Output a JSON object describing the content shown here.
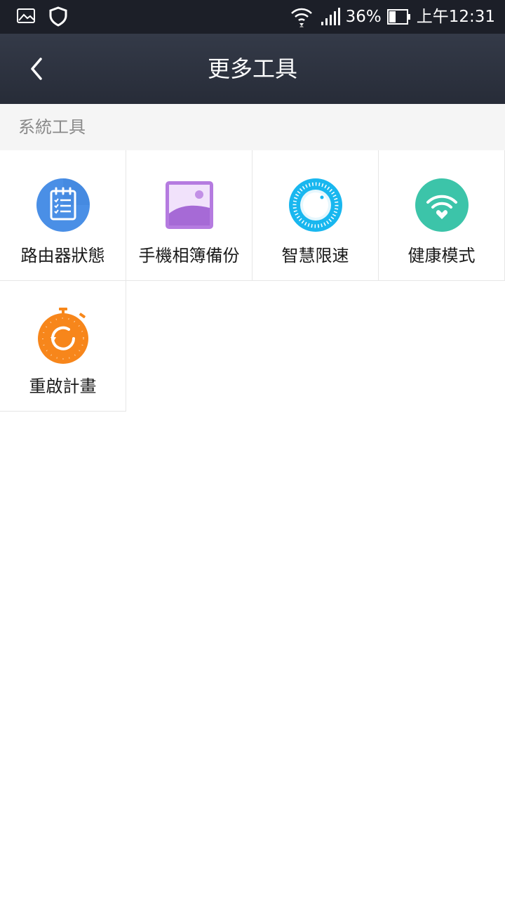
{
  "status_bar": {
    "battery_percent": "36%",
    "time": "上午12:31"
  },
  "header": {
    "title": "更多工具"
  },
  "section": {
    "title": "系統工具"
  },
  "tools": [
    {
      "label": "路由器狀態",
      "icon": "clipboard-checklist-icon",
      "color": "#4a90e2"
    },
    {
      "label": "手機相簿備份",
      "icon": "photo-album-icon",
      "color": "#a66fd6"
    },
    {
      "label": "智慧限速",
      "icon": "speed-dial-icon",
      "color": "#1fb6ee"
    },
    {
      "label": "健康模式",
      "icon": "wifi-heart-icon",
      "color": "#3cc2a8"
    },
    {
      "label": "重啟計畫",
      "icon": "restart-timer-icon",
      "color": "#f7871a"
    }
  ]
}
